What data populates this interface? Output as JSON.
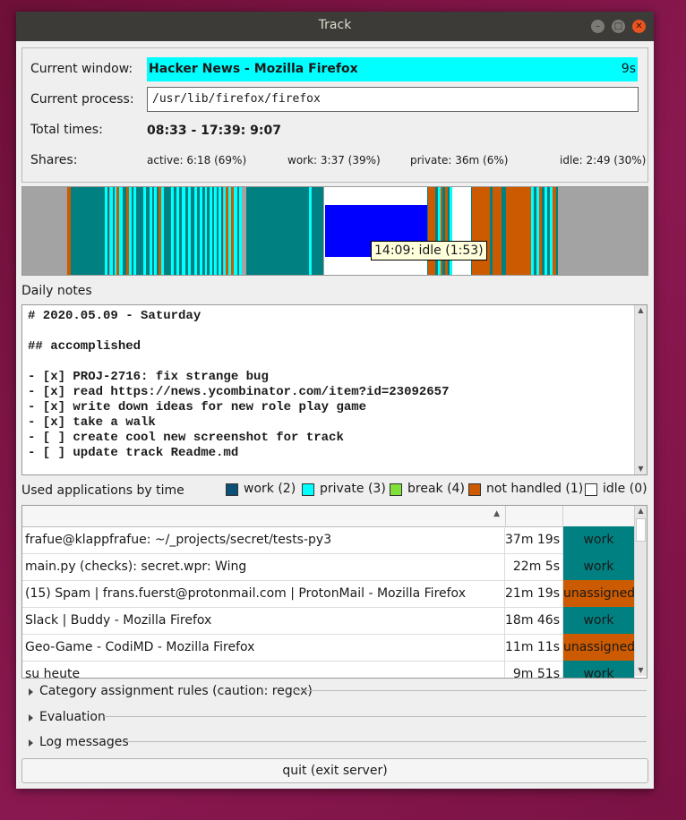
{
  "window": {
    "title": "Track"
  },
  "info": {
    "current_window_label": "Current window:",
    "current_window_value": "Hacker News - Mozilla Firefox",
    "current_window_time": "9s",
    "current_process_label": "Current process:",
    "current_process_value": "/usr/lib/firefox/firefox",
    "total_times_label": "Total times:",
    "total_times_value": "08:33 - 17:39: 9:07",
    "shares_label": "Shares:",
    "shares": [
      "active: 6:18 (69%)",
      "work: 3:37 (39%)",
      "private: 36m (6%)",
      "idle: 2:49 (30%)"
    ]
  },
  "timeline": {
    "colors": {
      "work": "#008080",
      "private": "#00ffff",
      "not_handled": "#cc5a00",
      "idle": "#ffffff",
      "off": "#a3a3a3",
      "highlight": "#0000ff"
    },
    "tooltip": "14:09: idle (1:53)"
  },
  "notes": {
    "label": "Daily notes",
    "lines": [
      "# 2020.05.09 - Saturday",
      "",
      "## accomplished",
      "",
      "- [x] PROJ-2716: fix strange bug",
      "- [x] read https://news.ycombinator.com/item?id=23092657",
      "- [x] write down ideas for new role play game",
      "- [x] take a walk",
      "- [ ] create cool new screenshot for track",
      "- [ ] update track Readme.md"
    ]
  },
  "apps": {
    "label": "Used applications by time",
    "legend": [
      {
        "text": "work (2)",
        "color": "#0b5077"
      },
      {
        "text": "private (3)",
        "color": "#00ffff"
      },
      {
        "text": "break (4)",
        "color": "#80e03a"
      },
      {
        "text": "not handled (1)",
        "color": "#cc5a00"
      },
      {
        "text": "idle (0)",
        "color": "#ffffff"
      }
    ],
    "category_colors": {
      "work": "#008080",
      "unassigned": "#cc5a00"
    },
    "rows": [
      {
        "name": "frafue@klappfrafue: ~/_projects/secret/tests-py3",
        "time": "37m 19s",
        "category": "work"
      },
      {
        "name": "main.py (checks): secret.wpr: Wing",
        "time": "22m 5s",
        "category": "work"
      },
      {
        "name": "(15) Spam | frans.fuerst@protonmail.com | ProtonMail - Mozilla Firefox",
        "time": "21m 19s",
        "category": "unassigned"
      },
      {
        "name": "Slack | Buddy - Mozilla Firefox",
        "time": "18m 46s",
        "category": "work"
      },
      {
        "name": "Geo-Game - CodiMD - Mozilla Firefox",
        "time": "11m 11s",
        "category": "unassigned"
      },
      {
        "name": "su heute",
        "time": "9m 51s",
        "category": "work"
      }
    ]
  },
  "expanders": [
    "Category assignment rules (caution: regex)",
    "Evaluation",
    "Log messages"
  ],
  "quit_label": "quit (exit server)"
}
